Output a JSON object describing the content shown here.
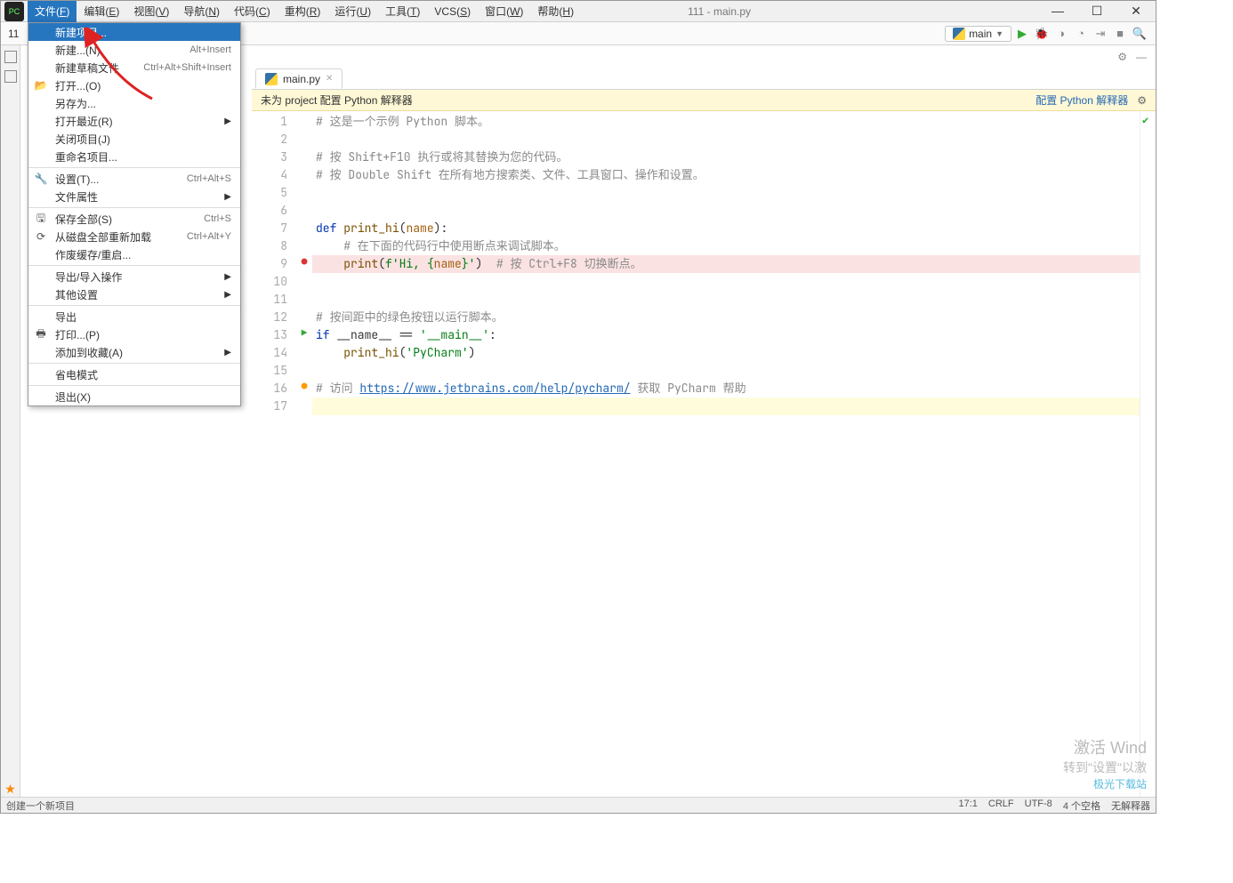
{
  "window_title": "111 - main.py",
  "menu": [
    "文件(F)",
    "编辑(E)",
    "视图(V)",
    "导航(N)",
    "代码(C)",
    "重构(R)",
    "运行(U)",
    "工具(T)",
    "VCS(S)",
    "窗口(W)",
    "帮助(H)"
  ],
  "breadcrumb_left": "11",
  "run_config": "main",
  "dropdown": {
    "items": [
      {
        "label": "新建项目...",
        "selected": true
      },
      {
        "label": "新建...(N)",
        "shortcut": "Alt+Insert"
      },
      {
        "label": "新建草稿文件",
        "shortcut": "Ctrl+Alt+Shift+Insert"
      },
      {
        "label": "打开...(O)",
        "icon": "📂"
      },
      {
        "label": "另存为..."
      },
      {
        "label": "打开最近(R)",
        "submenu": true
      },
      {
        "label": "关闭项目(J)"
      },
      {
        "label": "重命名项目..."
      },
      {
        "sep": true
      },
      {
        "label": "设置(T)...",
        "shortcut": "Ctrl+Alt+S",
        "icon": "🔧"
      },
      {
        "label": "文件属性",
        "submenu": true
      },
      {
        "sep": true
      },
      {
        "label": "保存全部(S)",
        "shortcut": "Ctrl+S",
        "icon": "🖫"
      },
      {
        "label": "从磁盘全部重新加载",
        "shortcut": "Ctrl+Alt+Y",
        "icon": "⟳"
      },
      {
        "label": "作废缓存/重启..."
      },
      {
        "sep": true
      },
      {
        "label": "导出/导入操作",
        "submenu": true
      },
      {
        "label": "其他设置",
        "submenu": true
      },
      {
        "sep": true
      },
      {
        "label": "导出"
      },
      {
        "label": "打印...(P)",
        "icon": "🖶"
      },
      {
        "label": "添加到收藏(A)",
        "submenu": true
      },
      {
        "sep": true
      },
      {
        "label": "省电模式"
      },
      {
        "sep": true
      },
      {
        "label": "退出(X)"
      }
    ]
  },
  "tab_name": "main.py",
  "notice_text": "未为 project 配置 Python 解释器",
  "notice_link": "配置 Python 解释器",
  "code_lines": [
    {
      "n": 1,
      "html": "<span class='c-cmt'># 这是一个示例 Python 脚本。</span>"
    },
    {
      "n": 2,
      "html": ""
    },
    {
      "n": 3,
      "html": "<span class='c-cmt'># 按 Shift+F10 执行或将其替换为您的代码。</span>"
    },
    {
      "n": 4,
      "html": "<span class='c-cmt'># 按 Double Shift 在所有地方搜索类、文件、工具窗口、操作和设置。</span>"
    },
    {
      "n": 5,
      "html": ""
    },
    {
      "n": 6,
      "html": ""
    },
    {
      "n": 7,
      "html": "<span class='c-kw'>def</span> <span class='c-fn'>print_hi</span>(<span class='c-name'>name</span>):"
    },
    {
      "n": 8,
      "html": "    <span class='c-cmt'># 在下面的代码行中使用断点来调试脚本。</span>"
    },
    {
      "n": 9,
      "cls": "hl-pink",
      "mark": "●",
      "mcol": "#d33",
      "html": "    <span class='c-fn'>print</span>(<span class='c-str'>f'Hi, {</span><span class='c-name'>name</span><span class='c-str'>}'</span>)  <span class='c-cmt'># 按 Ctrl+F8 切换断点。</span>"
    },
    {
      "n": 10,
      "html": ""
    },
    {
      "n": 11,
      "html": ""
    },
    {
      "n": 12,
      "html": "<span class='c-cmt'># 按间距中的绿色按钮以运行脚本。</span>"
    },
    {
      "n": 13,
      "mark": "▶",
      "mcol": "#3a3",
      "html": "<span class='c-kw'>if</span> __name__ == <span class='c-str'>'__main__'</span>:"
    },
    {
      "n": 14,
      "html": "    <span class='c-fn'>print_hi</span>(<span class='c-str'>'PyCharm'</span>)"
    },
    {
      "n": 15,
      "html": ""
    },
    {
      "n": 16,
      "mark": "●",
      "mcol": "#f90",
      "html": "<span class='c-cmt'># 访问 </span><span class='c-link'>https://www.jetbrains.com/help/pycharm/</span><span class='c-cmt'> 获取 PyCharm 帮助</span>"
    },
    {
      "n": 17,
      "cls": "hl-yel",
      "html": ""
    }
  ],
  "status_left": "创建一个新项目",
  "status_right": [
    "17:1",
    "CRLF",
    "UTF-8",
    "4 个空格",
    "无解释器"
  ],
  "watermark": {
    "big": "激活 Wind",
    "small": "转到\"设置\"以激"
  },
  "logo_text": "极光下载站"
}
